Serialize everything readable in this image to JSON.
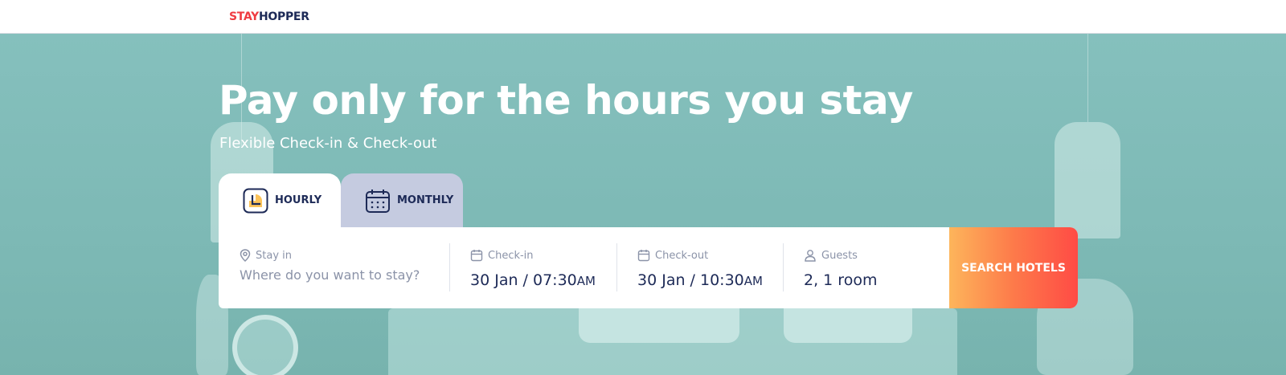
{
  "brand": {
    "logo_part1": "STAY",
    "logo_part2": "HOPPER"
  },
  "hero": {
    "headline": "Pay only for the hours you stay",
    "subline": "Flexible Check-in & Check-out"
  },
  "tabs": [
    {
      "label": "HOURLY",
      "icon": "clock-icon",
      "active": true
    },
    {
      "label": "MONTHLY",
      "icon": "calendar-icon",
      "active": false
    }
  ],
  "search": {
    "stay_in": {
      "label": "Stay in",
      "placeholder": "Where do you want to stay?"
    },
    "check_in": {
      "label": "Check-in",
      "value": "30 Jan / 07:30",
      "ampm": "AM"
    },
    "check_out": {
      "label": "Check-out",
      "value": "30 Jan / 10:30",
      "ampm": "AM"
    },
    "guests": {
      "label": "Guests",
      "value": "2, 1 room"
    },
    "button_label": "SEARCH HOTELS"
  },
  "colors": {
    "brand_red": "#ef3b41",
    "brand_navy": "#1d2a57",
    "hero_teal": "#82bdb9",
    "button_gradient_start": "#fdb55b",
    "button_gradient_end": "#ff4b45"
  }
}
